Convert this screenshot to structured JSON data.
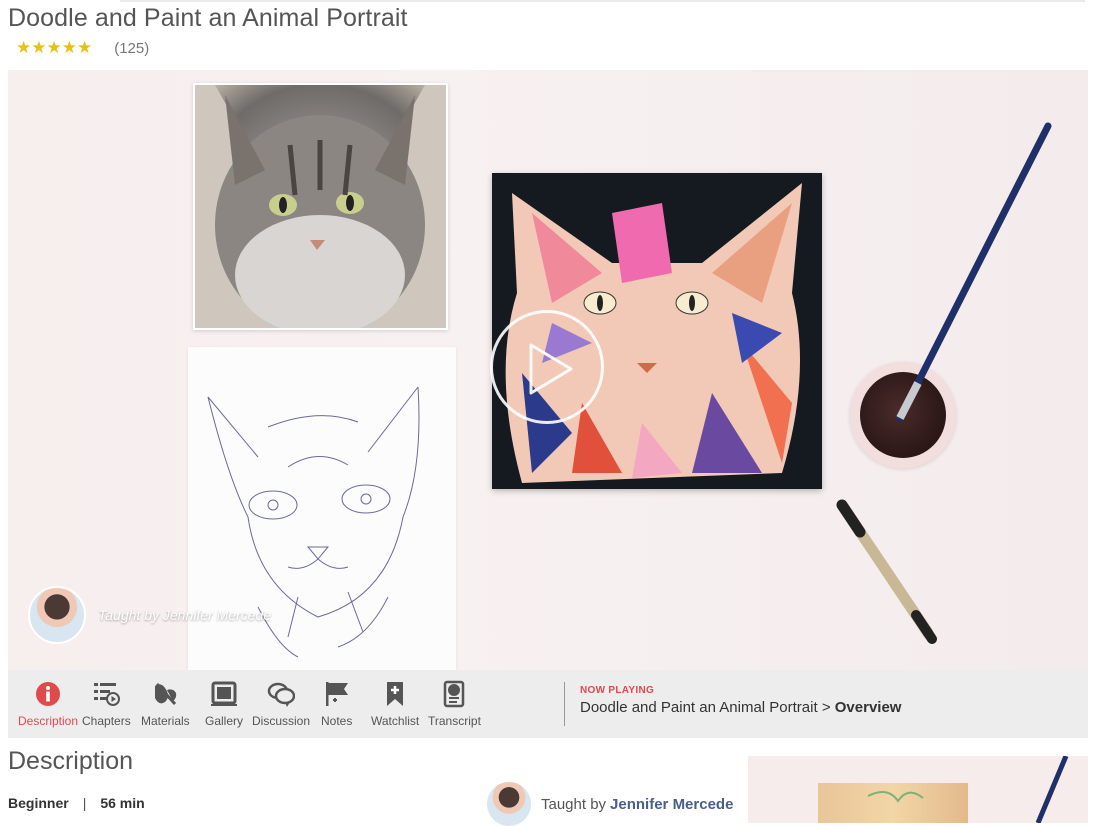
{
  "course": {
    "title": "Doodle and Paint an Animal Portrait",
    "stars": "★★★★★",
    "rating_count": "(125)"
  },
  "video": {
    "instructor_caption": "Taught by Jennifer Mercede"
  },
  "toolbar": {
    "tabs": [
      {
        "label": "Description",
        "icon": "info-icon",
        "active": true
      },
      {
        "label": "Chapters",
        "icon": "chapters-icon"
      },
      {
        "label": "Materials",
        "icon": "materials-icon"
      },
      {
        "label": "Gallery",
        "icon": "gallery-icon"
      },
      {
        "label": "Discussion",
        "icon": "discussion-icon"
      },
      {
        "label": "Notes",
        "icon": "notes-flag-icon"
      },
      {
        "label": "Watchlist",
        "icon": "bookmark-icon"
      },
      {
        "label": "Transcript",
        "icon": "transcript-icon"
      }
    ],
    "now_playing": {
      "label": "NOW PLAYING",
      "course": "Doodle and Paint an Animal Portrait",
      "separator": " > ",
      "chapter": "Overview"
    }
  },
  "description": {
    "title": "Description",
    "level": "Beginner",
    "separator": "|",
    "duration": "56 min",
    "taught_by": "Taught by",
    "instructor": "Jennifer Mercede"
  },
  "colors": {
    "accent_red": "#e04a4a",
    "star_gold": "#e6c219",
    "link_blue": "#4a5e8d",
    "toolbar_bg": "#ededed"
  }
}
